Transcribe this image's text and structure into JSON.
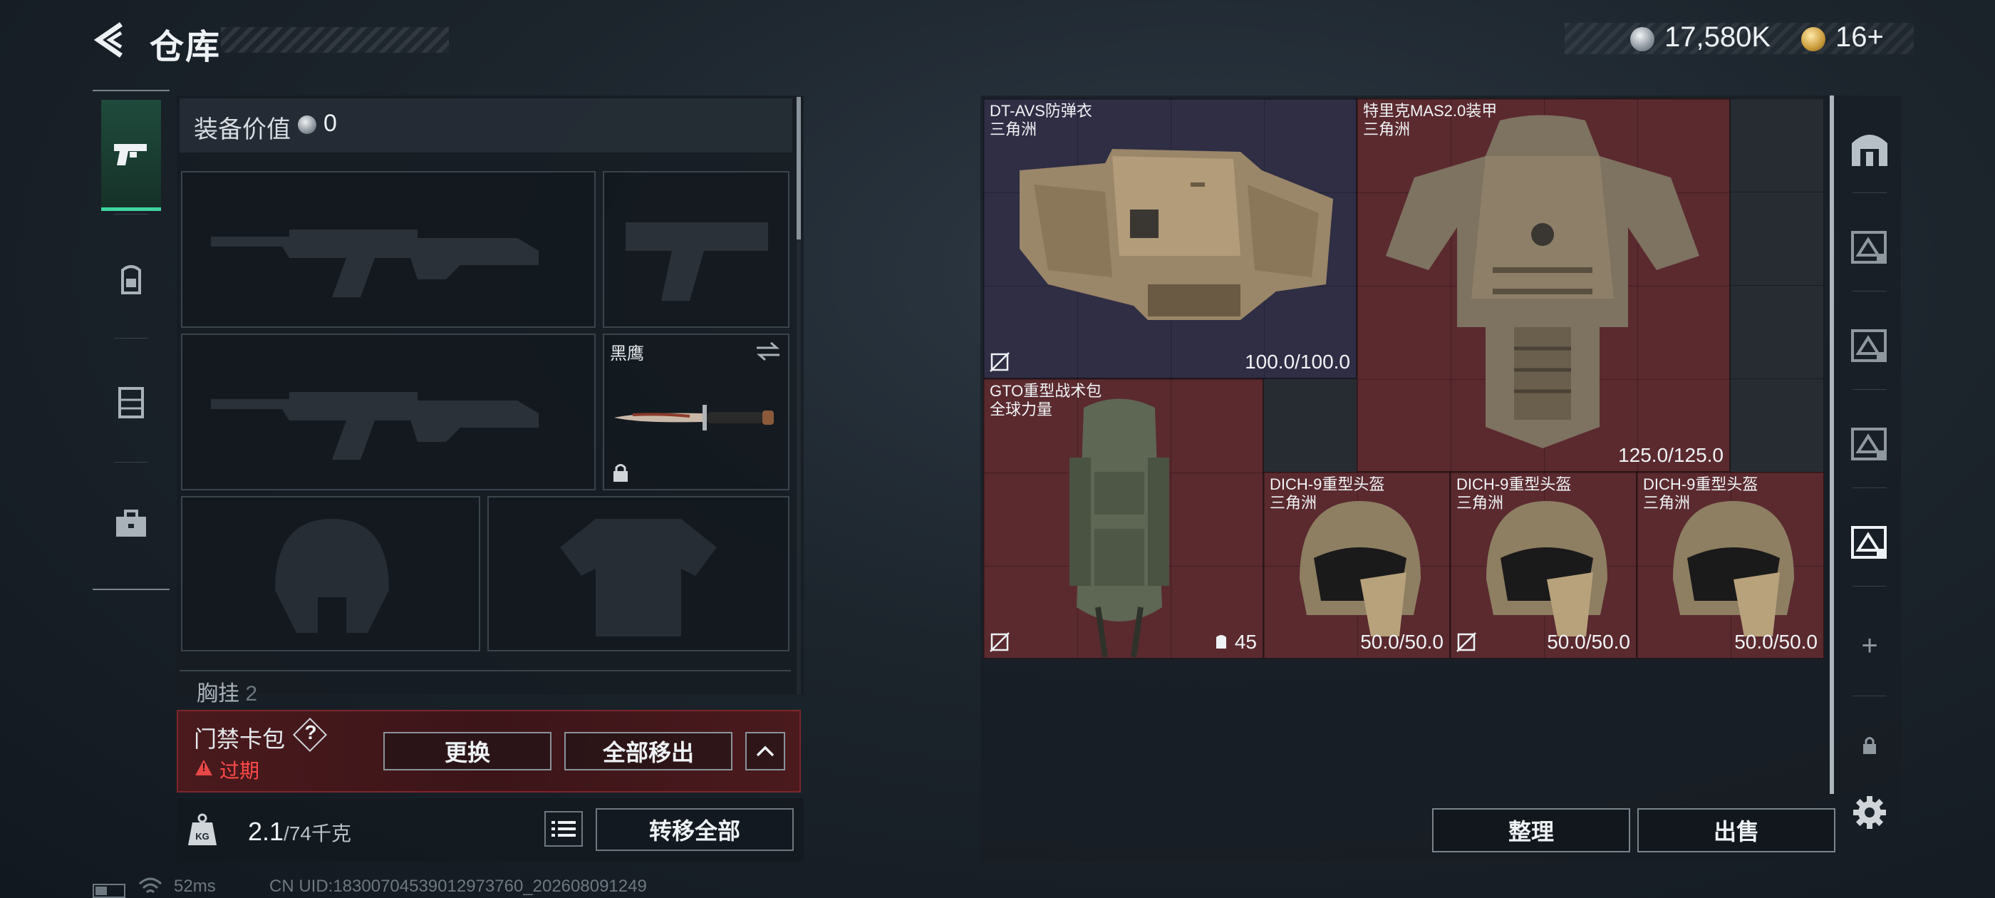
{
  "header": {
    "title": "仓库",
    "currency": {
      "silver": "17,580K",
      "gold": "16+"
    }
  },
  "side_nav": {
    "items": [
      {
        "icon": "pistol-icon",
        "active": true
      },
      {
        "icon": "backpack-icon",
        "active": false
      },
      {
        "icon": "chest-rig-icon",
        "active": false
      },
      {
        "icon": "briefcase-icon",
        "active": false
      }
    ]
  },
  "loadout": {
    "equip_value_label": "装备价值",
    "equip_value": "0",
    "melee_name": "黑鹰",
    "chest_label": "胸挂",
    "chest_value": "2"
  },
  "keycard": {
    "title": "门禁卡包",
    "help": "?",
    "status": "过期",
    "replace_button": "更换",
    "move_all_button": "全部移出",
    "status_color": "#ff4a4a"
  },
  "weight": {
    "current": "2.1",
    "max": "/74千克",
    "transfer_all_button": "转移全部"
  },
  "stash": {
    "items": [
      {
        "name": "DT-AVS防弹衣",
        "sub": "三角洲",
        "durability": "100.0/100.0",
        "rarity": "purple"
      },
      {
        "name": "特里克MAS2.0装甲",
        "sub": "三角洲",
        "durability": "125.0/125.0",
        "rarity": "red"
      },
      {
        "name": "GTO重型战术包",
        "sub": "全球力量",
        "capacity": "45",
        "rarity": "red"
      },
      {
        "name": "DICH-9重型头盔",
        "sub": "三角洲",
        "durability": "50.0/50.0",
        "rarity": "red"
      },
      {
        "name": "DICH-9重型头盔",
        "sub": "三角洲",
        "durability": "50.0/50.0",
        "rarity": "red"
      },
      {
        "name": "DICH-9重型头盔",
        "sub": "三角洲",
        "durability": "50.0/50.0",
        "rarity": "red"
      }
    ],
    "sort_button": "整理",
    "sell_button": "出售"
  },
  "right_tabs": {
    "add_label": "+"
  },
  "status_bar": {
    "ping": "52ms",
    "uid": "CN UID:18300704539012973760_202608091249"
  },
  "colors": {
    "accent_green": "#3fd6a0",
    "rarity_red": "#5a2a2f",
    "rarity_purple": "#2f2e45"
  }
}
